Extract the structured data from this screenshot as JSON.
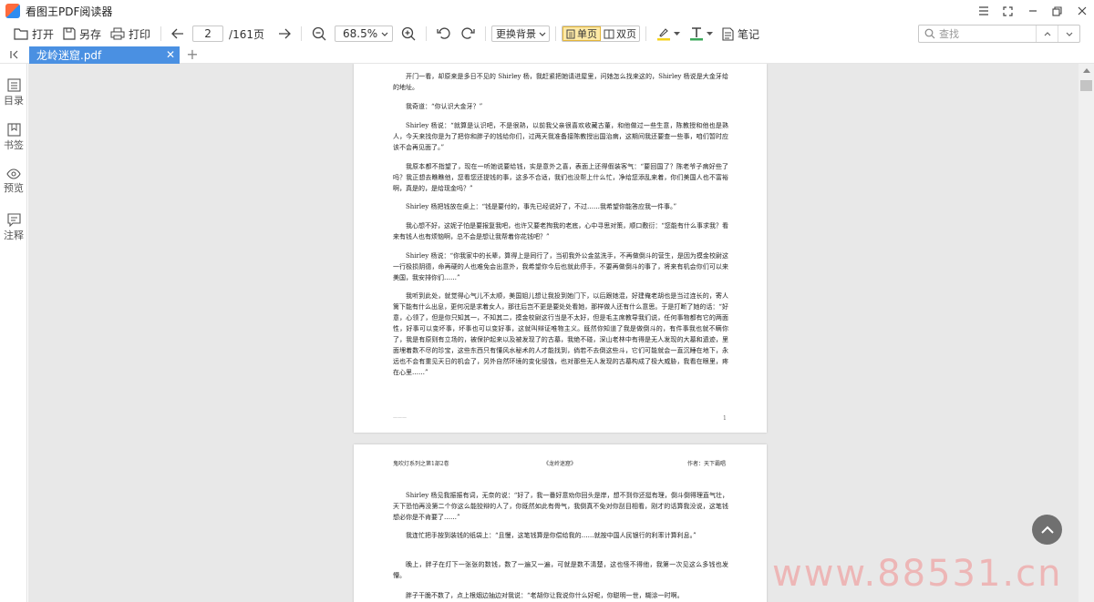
{
  "app": {
    "title": "看图王PDF阅读器"
  },
  "toolbar": {
    "open_label": "打开",
    "saveas_label": "另存",
    "print_label": "打印",
    "page_current": "2",
    "page_total": "/161页",
    "zoom_value": "68.5%",
    "bg_label": "更换背景",
    "single_label": "单页",
    "double_label": "双页",
    "notes_label": "笔记",
    "search_placeholder": "查找"
  },
  "tabs": [
    {
      "label": "龙岭迷窟.pdf"
    }
  ],
  "sidebar": {
    "items": [
      {
        "label": "目录"
      },
      {
        "label": "书签"
      },
      {
        "label": "预览"
      },
      {
        "label": "注释"
      }
    ]
  },
  "pages": {
    "page1": {
      "paragraphs": [
        "开门一看，却原来是多日不见的 Shirley 杨，我赶紧把她请进屋里，问她怎么找来这的，Shirley 杨说是大金牙给的地址。",
        "我奇道：“你认识大金牙？”",
        "Shirley 杨说：“就算是认识吧，不是很熟，以前我父亲很喜欢收藏古董，和他做过一些生意，陈教授和他也是熟人，今天来找你是为了把你和胖子的钱给你们，过两天我准备接陈教授出国治病，这期间我还要查一些事，咱们暂时应该不会再见面了。”",
        "我原本都不指望了，现在一听她说要给钱，实是意外之喜，表面上还得假装客气：“要回国了？陈老爷子病好些了吗？我正想去瞧瞧他，您看您还提钱的事，这多不合适，我们也没帮上什么忙，净给您添乱来着，你们美国人也不富裕啊，真是的，是给现金吗？”",
        "Shirley 杨把钱放在桌上：“钱是要付的，事先已经说好了，不过……我希望你能答应我一件事。”",
        "我心想不好，这妮子怕是要报复我吧，也许又要老掏我的老底，心中寻思对策，顺口敷衍：“您能有什么事求我？看来有钱人也有烦恼啊，总不会是想让我帮着你花钱吧？”",
        "Shirley 杨说：“你我家中的长辈，算得上是同行了，当初我外公金盆洗手，不再做倒斗的营生，是因为摸金校尉这一行极损阴德，命再硬的人也难免会出意外，我希望你今后也就此停手，不要再做倒斗的事了，将来有机会你们可以来美国，我安排你们……”",
        "我听到此处，就觉得心气儿不太顺，美国姐儿想让我投到她门下，以后跟她混，好建俺老胡也是当过连长的，寄人篱下能有什么出息，更何况是求着女人，那往后岂不更是要处处看她，那样做人还有什么意思。于是打断了她的话：“好意，心领了，但是你只知其一，不知其二，摸金校尉这行当是不太好，但是毛主席教导我们说，任何事物都有它的两面性，好事可以变坏事，坏事也可以变好事，这就叫辩证唯物主义。既然你知道了我是做倒斗的，有件事我也就不瞒你了，我是有原则有立场的，被保护起来以及被发现了的古墓，我绝不碰，深山老林中有得是无人发现的大墓和遗迹，里面埋着数不尽的珍宝，这些东西只有懂风水秘术的人才能找到，倘若不去倒这些斗，它们可能就会一直沉睡在地下，永远也不会有重见天日的机会了，另外自然环境的变化侵蚀，也对那些无人发现的古墓构成了极大威胁，我看在眼里，疼在心里……”"
      ],
      "page_number": "1"
    },
    "page2": {
      "head_left": "鬼吹灯系列之第1部2卷",
      "head_center": "《龙岭迷窟》",
      "head_right": "作者：天下霸唱",
      "paragraphs": [
        "Shirley 杨见我振振有词，无奈的说：“好了，我一番好意劝你回头是岸，想不到你还挺有理，倒斗倒得理直气壮，天下恐怕再没第二个你这么能狡辩的人了，你既然如此有骨气，我倒真不免对你刮目相看，刚才的话算我没说，这笔钱想必你是不肯要了……”",
        "我连忙把手按到装钱的纸袋上：“且慢，这笔钱算是你偿给我的……就按中国人民银行的利率计算利息。”",
        "晚上，胖子在灯下一张张的数钱，数了一遍又一遍，可就是数不清楚，这也怪不得他，我第一次见这么多钱也发懵。",
        "胖子干脆不数了，点上根烟边抽边对我说：“老胡你让我说你什么好呢，你聪明一世，糊涂一时啊。"
      ]
    }
  },
  "watermark": "www.88531.cn"
}
